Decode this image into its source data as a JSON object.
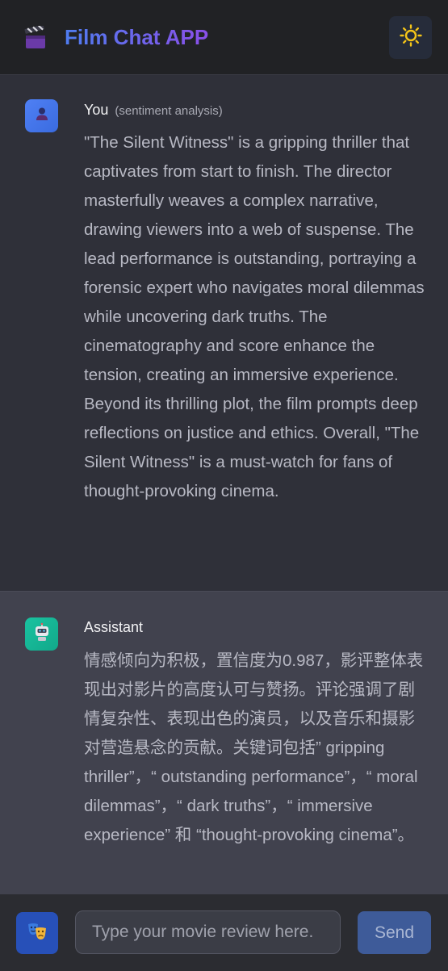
{
  "header": {
    "logo_icon": "clapperboard-icon",
    "title": "Film Chat APP",
    "theme_icon": "sun-icon"
  },
  "messages": [
    {
      "role": "user",
      "avatar_icon": "user-icon",
      "sender": "You",
      "tag": "(sentiment analysis)",
      "text": "\"The Silent Witness\" is a gripping thriller that captivates from start to finish. The director masterfully weaves a complex narrative, drawing viewers into a web of suspense. The lead performance is outstanding, portraying a forensic expert who navigates moral dilemmas while uncovering dark truths. The cinematography and score enhance the tension, creating an immersive experience. Beyond its thrilling plot, the film prompts deep reflections on justice and ethics. Overall, \"The Silent Witness\" is a must-watch for fans of thought-provoking cinema."
    },
    {
      "role": "assistant",
      "avatar_icon": "robot-icon",
      "sender": "Assistant",
      "text": "情感倾向为积极，置信度为0.987，影评整体表现出对影片的高度认可与赞扬。评论强调了剧情复杂性、表现出色的演员，以及音乐和摄影对营造悬念的贡献。关键词包括” gripping thriller”，“ outstanding performance”，“ moral dilemmas”，“ dark truths”，“ immersive experience” 和 “thought-provoking cinema”。"
    }
  ],
  "footer": {
    "mode_icon": "theater-masks-icon",
    "input_placeholder": "Type your movie review here.",
    "input_value": "",
    "send_label": "Send"
  },
  "colors": {
    "title_gradient_start": "#4f7df0",
    "title_gradient_end": "#8a4fe8",
    "send_button": "#3e5b99",
    "user_avatar": "#4f80f4",
    "assistant_avatar": "#19c3a0",
    "sun": "#f5c518"
  }
}
